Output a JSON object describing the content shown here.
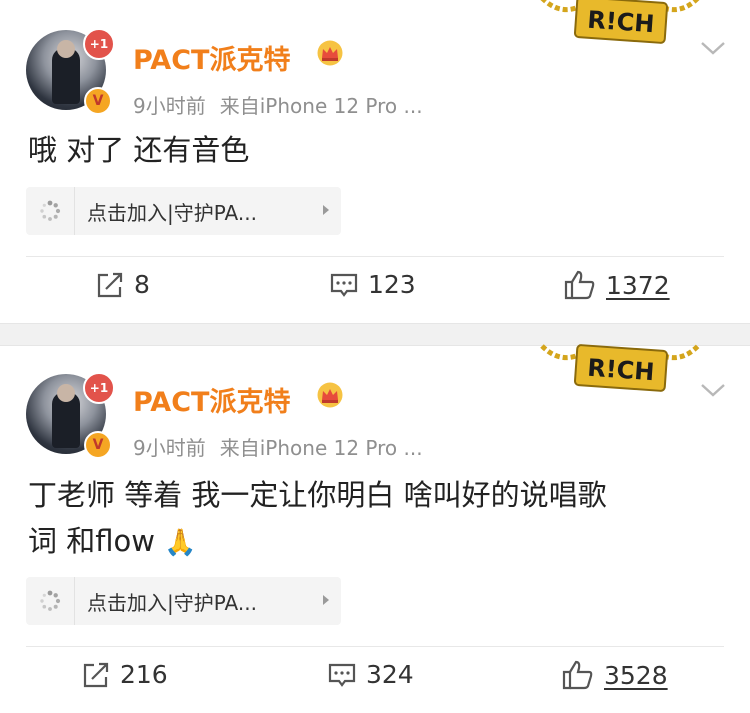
{
  "posts": [
    {
      "username": "PACT派克特",
      "avatar_badge": "+1",
      "verified_badge": "V",
      "time": "9小时前",
      "source": "来自iPhone 12 Pro ...",
      "content_lines": [
        "哦 对了 还有音色"
      ],
      "interaction_label": "点击加入|守护PA...",
      "reposts": "8",
      "comments": "123",
      "likes": "1372"
    },
    {
      "username": "PACT派克特",
      "avatar_badge": "+1",
      "verified_badge": "V",
      "time": "9小时前",
      "source": "来自iPhone 12 Pro ...",
      "content_lines": [
        "丁老师 等着 我一定让你明白 啥叫好的说唱歌",
        "词 和flow"
      ],
      "content_emoji": "🙏",
      "interaction_label": "点击加入|守护PA...",
      "reposts": "216",
      "comments": "324",
      "likes": "3528"
    }
  ],
  "decoration": {
    "chain_text": "R!CH"
  },
  "colors": {
    "username": "#f17f1b",
    "meta": "#8f8f8f",
    "badge_red": "#e2534b",
    "badge_gold": "#f5a623"
  }
}
